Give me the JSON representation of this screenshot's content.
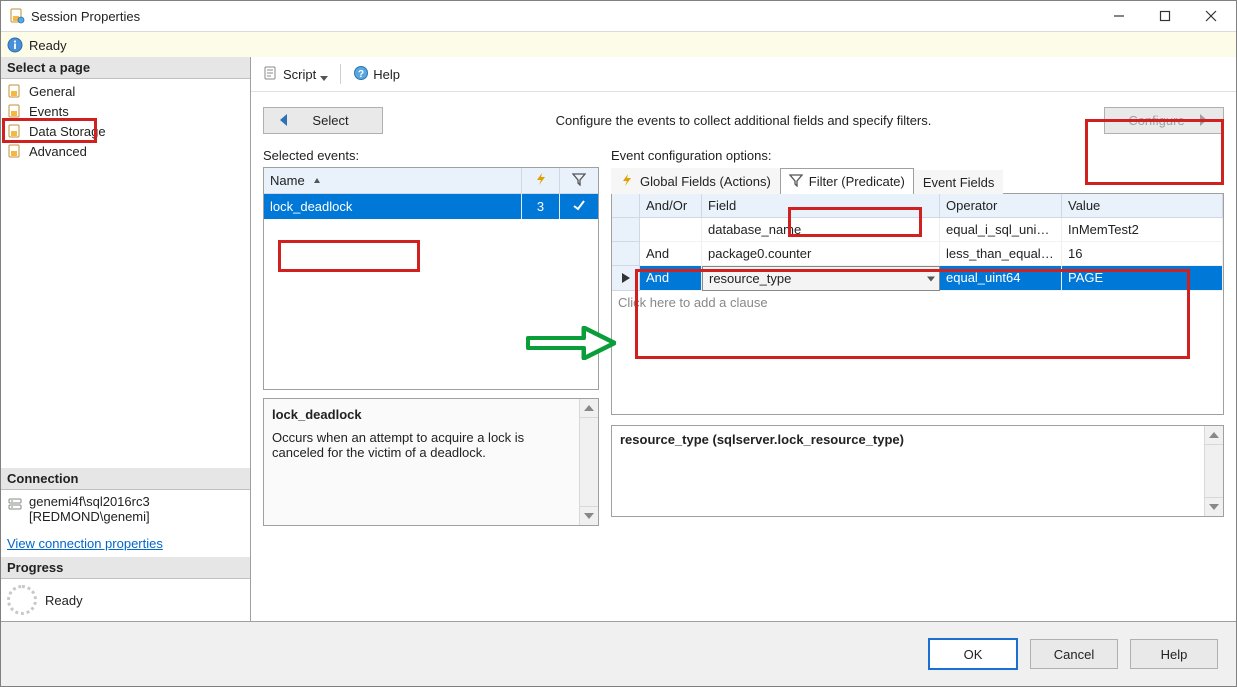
{
  "window": {
    "title": "Session Properties"
  },
  "readybar": {
    "text": "Ready"
  },
  "sidebar": {
    "select_page_header": "Select a page",
    "pages": [
      {
        "label": "General"
      },
      {
        "label": "Events"
      },
      {
        "label": "Data Storage"
      },
      {
        "label": "Advanced"
      }
    ],
    "connection_header": "Connection",
    "connection_server": "genemi4f\\sql2016rc3",
    "connection_user": "[REDMOND\\genemi]",
    "view_connection_link": "View connection properties",
    "progress_header": "Progress",
    "progress_text": "Ready"
  },
  "toolbar": {
    "script_label": "Script",
    "help_label": "Help"
  },
  "work": {
    "select_button": "Select",
    "configure_button": "Configure",
    "instruction": "Configure the events to collect additional fields and specify filters.",
    "selected_events_label": "Selected events:",
    "event_config_label": "Event configuration options:",
    "selected_events": {
      "col_name": "Name",
      "rows": [
        {
          "name": "lock_deadlock",
          "actions": "3",
          "filtered": "✔"
        }
      ]
    },
    "event_desc": {
      "title": "lock_deadlock",
      "body": "Occurs when an attempt to acquire a lock is canceled for the victim of a deadlock."
    },
    "tabs": {
      "global_fields": "Global Fields (Actions)",
      "filter": "Filter (Predicate)",
      "event_fields": "Event Fields"
    },
    "predicate": {
      "col_andor": "And/Or",
      "col_field": "Field",
      "col_operator": "Operator",
      "col_value": "Value",
      "rows": [
        {
          "andor": "",
          "field": "database_name",
          "operator": "equal_i_sql_uni…",
          "value": "InMemTest2"
        },
        {
          "andor": "And",
          "field": "package0.counter",
          "operator": "less_than_equal…",
          "value": "16"
        },
        {
          "andor": "And",
          "field": "resource_type",
          "operator": "equal_uint64",
          "value": "PAGE"
        }
      ],
      "add_clause_hint": "Click here to add a clause"
    },
    "type_desc": "resource_type (sqlserver.lock_resource_type)"
  },
  "buttons": {
    "ok": "OK",
    "cancel": "Cancel",
    "help": "Help"
  }
}
